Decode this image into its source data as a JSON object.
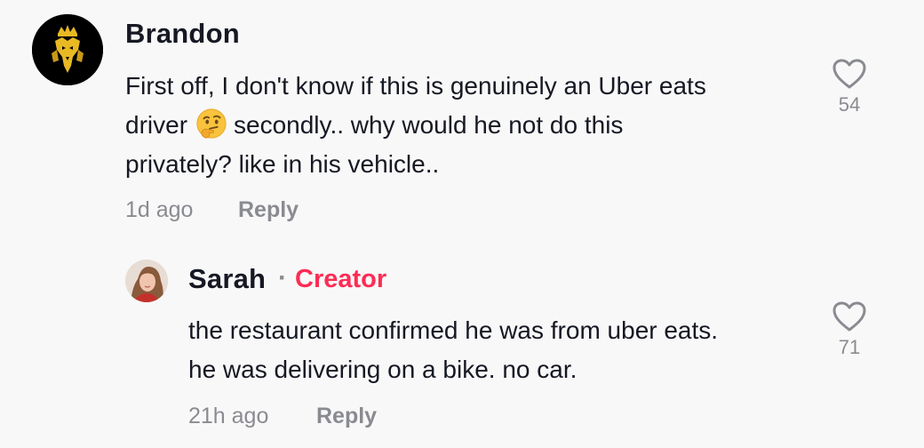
{
  "comments": [
    {
      "username": "Brandon",
      "text_lines": [
        "First off, I don't know if this is genuinely an Uber eats",
        "driver",
        "secondly.. why would he not do this",
        "privately? like in his vehicle.."
      ],
      "emoji": "thinking-face",
      "likes": "54",
      "time": "1d ago",
      "reply_label": "Reply"
    },
    {
      "username": "Sarah",
      "separator": "·",
      "badge": "Creator",
      "text_lines": [
        "the restaurant confirmed he was from uber eats.",
        "he was delivering on a bike. no car."
      ],
      "likes": "71",
      "time": "21h ago",
      "reply_label": "Reply"
    }
  ],
  "colors": {
    "background": "#f8f8f8",
    "text": "#161823",
    "muted": "#8a8b91",
    "creator": "#fe2c55"
  }
}
